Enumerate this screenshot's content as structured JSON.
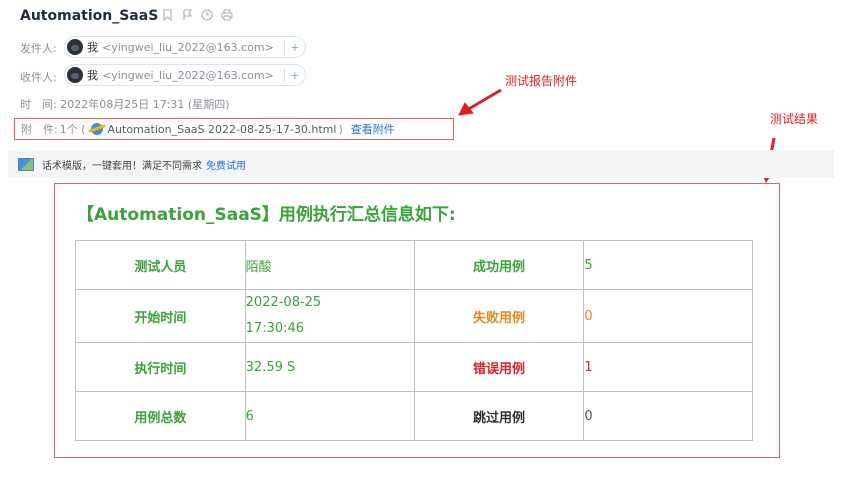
{
  "email": {
    "subject": "Automation_SaaS",
    "header_icons": [
      "bookmark-icon",
      "flag-icon",
      "clock-icon",
      "print-icon"
    ],
    "from": {
      "label": "发件人:",
      "name": "我",
      "email": "<yingwei_liu_2022@163.com>",
      "add": "+"
    },
    "to": {
      "label": "收件人:",
      "name": "我",
      "email": "<yingwei_liu_2022@163.com>",
      "add": "+"
    },
    "time": {
      "label": "时　间:",
      "value": "2022年08月25日 17:31 (星期四)"
    },
    "attachment": {
      "label": "附　件:",
      "count": "1个 (",
      "filename": "Automation_SaaS 2022-08-25-17-30.html",
      "close": ")",
      "view_link": "查看附件"
    }
  },
  "annotations": {
    "attachment_note": "测试报告附件",
    "result_note": "测试结果",
    "color": "#e02020"
  },
  "promo": {
    "text": "话术模版，一键套用！满足不同需求",
    "link": "免费试用"
  },
  "report": {
    "title": "【Automation_SaaS】用例执行汇总信息如下:",
    "rows": [
      {
        "label1": "测试人员",
        "value1": "陌酸",
        "label2": "成功用例",
        "value2": "5"
      },
      {
        "label1": "开始时间",
        "value1_line1": "2022-08-25",
        "value1_line2": "17:30:46",
        "label2": "失败用例",
        "value2": "0"
      },
      {
        "label1": "执行时间",
        "value1": "32.59 S",
        "label2": "错误用例",
        "value2": "1"
      },
      {
        "label1": "用例总数",
        "value1": "6",
        "label2": "跳过用例",
        "value2": "0"
      }
    ],
    "colors": {
      "green": "#3aa33a",
      "orange": "#e08a1e",
      "red": "#d9232d"
    }
  }
}
